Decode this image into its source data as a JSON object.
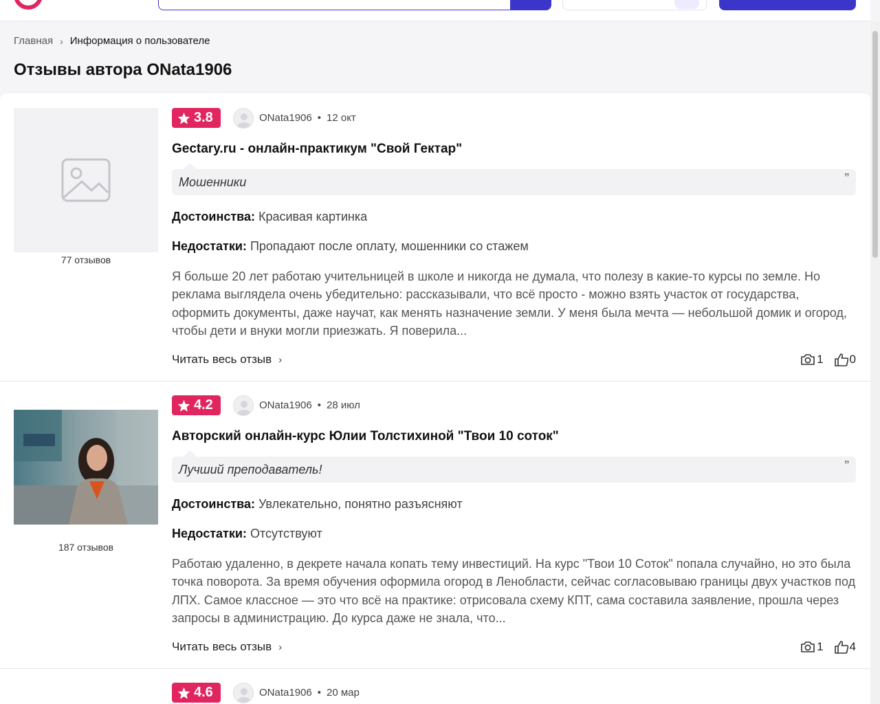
{
  "breadcrumb": {
    "home": "Главная",
    "separator": "›",
    "current": "Информация о пользователе"
  },
  "page_title": "Отзывы автора ONata1906",
  "colors": {
    "accent": "#e0255f",
    "brand": "#3b36c9"
  },
  "reviews": [
    {
      "rating": "3.8",
      "author": "ONata1906",
      "date": "12 окт",
      "title": "Gectary.ru - онлайн-практикум \"Свой Гектар\"",
      "quote": "Мошенники",
      "quote_mark": "”",
      "pros_label": "Достоинства:",
      "pros": "Красивая картинка",
      "cons_label": "Недостатки:",
      "cons": "Пропадают после оплату, мошенники со стажем",
      "body": "Я больше 20 лет работаю учительницей в школе и никогда не думала, что полезу в какие-то курсы по земле. Но реклама выглядела очень убедительно: рассказывали, что всё просто - можно взять участок от государства, оформить документы, даже научат, как менять назначение земли. У меня была мечта — небольшой домик и огород, чтобы дети и внуки могли приезжать. Я поверила...",
      "read_more": "Читать весь отзыв",
      "photos": "1",
      "likes": "0",
      "review_count": "77 отзывов",
      "image": "placeholder-image-icon"
    },
    {
      "rating": "4.2",
      "author": "ONata1906",
      "date": "28 июл",
      "title": "Авторский онлайн-курс Юлии Толстихиной \"Твои 10 соток\"",
      "quote": "Лучший преподаватель!",
      "quote_mark": "”",
      "pros_label": "Достоинства:",
      "pros": "Увлекательно, понятно разъясняют",
      "cons_label": "Недостатки:",
      "cons": "Отсутствуют",
      "body": "Работаю удаленно, в декрете начала копать тему инвестиций. На курс \"Твои 10 Соток\" попала случайно, но это была точка поворота. За время обучения оформила огород в Ленобласти, сейчас согласовываю границы двух участков под ЛПХ. Самое классное — это что всё на практике: отрисовала схему КПТ, сама составила заявление, прошла через запросы в администрацию. До курса даже не знала, что...",
      "read_more": "Читать весь отзыв",
      "photos": "1",
      "likes": "4",
      "review_count": "187 отзывов",
      "image": "course-author-photo"
    },
    {
      "rating": "4.6",
      "author": "ONata1906",
      "date": "20 мар"
    }
  ]
}
